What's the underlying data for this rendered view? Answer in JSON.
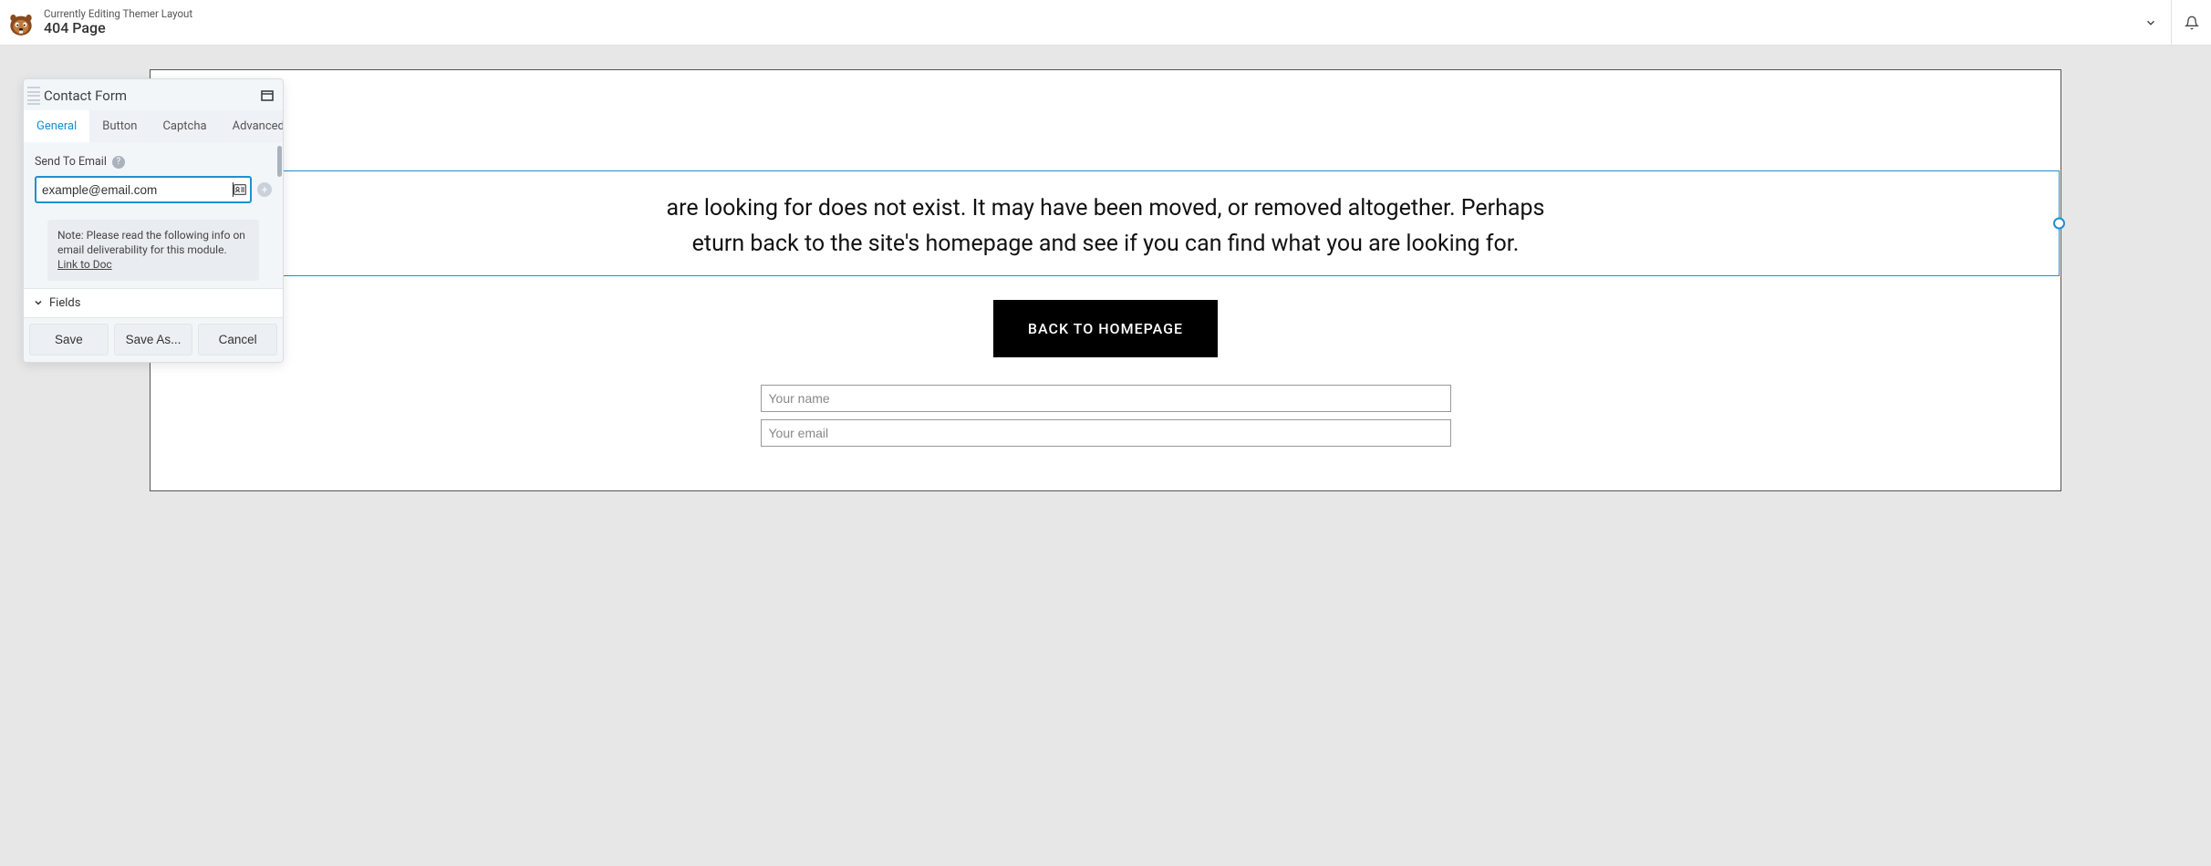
{
  "topbar": {
    "subtitle": "Currently Editing Themer Layout",
    "title": "404 Page"
  },
  "panel": {
    "title": "Contact Form",
    "tabs": [
      "General",
      "Button",
      "Captcha",
      "Advanced"
    ],
    "active_tab_index": 0,
    "fields": {
      "send_to_label": "Send To Email",
      "send_to_value": "example@email.com",
      "note_pre": "Note: Please read the following info on email deliverability for this module. ",
      "note_link": "Link to Doc"
    },
    "section_label": "Fields",
    "footer": {
      "save": "Save",
      "save_as": "Save As...",
      "cancel": "Cancel"
    }
  },
  "page": {
    "lead": "are looking for does not exist. It may have been moved, or removed altogether. Perhaps\neturn back to the site's homepage and see if you can find what you are looking for.",
    "cta": "BACK TO HOMEPAGE",
    "form": {
      "name_placeholder": "Your name",
      "email_placeholder": "Your email"
    }
  }
}
